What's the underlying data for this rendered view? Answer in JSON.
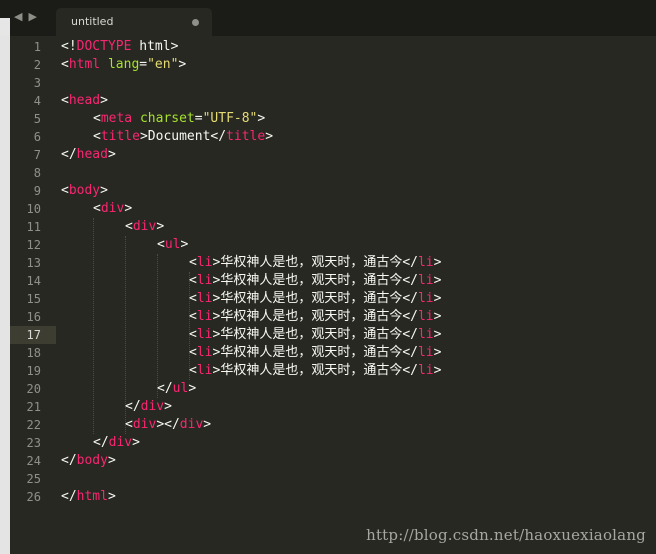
{
  "window": {
    "tab_title": "untitled",
    "active_line": 17
  },
  "line_numbers": [
    "1",
    "2",
    "3",
    "4",
    "5",
    "6",
    "7",
    "8",
    "9",
    "10",
    "11",
    "12",
    "13",
    "14",
    "15",
    "16",
    "17",
    "18",
    "19",
    "20",
    "21",
    "22",
    "23",
    "24",
    "25",
    "26"
  ],
  "code": {
    "doctype_open": "<!",
    "doctype_kw": "DOCTYPE",
    "doctype_rest": " html>",
    "html_open": "html",
    "attr_lang": "lang",
    "lang_value": "\"en\"",
    "head_open": "head",
    "meta_tag": "meta",
    "attr_charset": "charset",
    "charset_value": "\"UTF-8\"",
    "title_tag": "title",
    "title_text": "Document",
    "body_tag": "body",
    "div_tag": "div",
    "ul_tag": "ul",
    "li_tag": "li",
    "li_text": "华权神人是也，观天时，通古今",
    "html_close": "html"
  },
  "watermark": "http://blog.csdn.net/haoxuexiaolang"
}
